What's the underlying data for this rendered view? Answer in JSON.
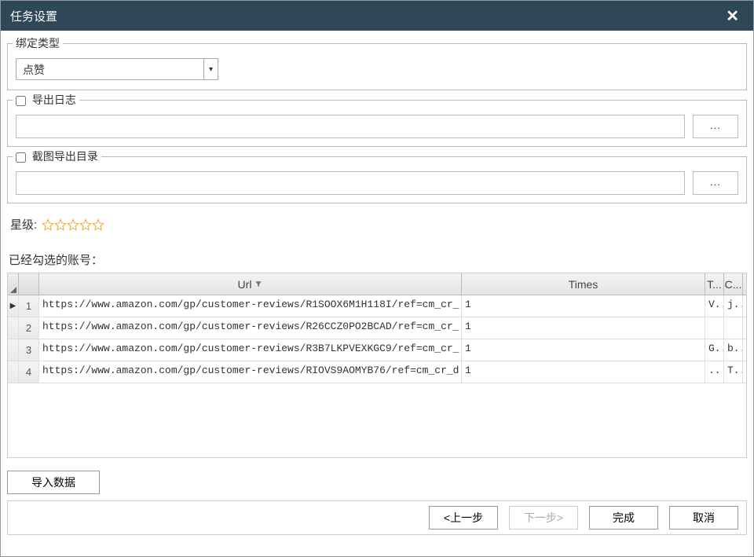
{
  "window": {
    "title": "任务设置"
  },
  "bind_type": {
    "legend": "绑定类型",
    "selected": "点赞"
  },
  "export_log": {
    "legend": "导出日志",
    "path": "",
    "browse": "..."
  },
  "screenshot_dir": {
    "legend": "截图导出目录",
    "path": "",
    "browse": "..."
  },
  "rating": {
    "label": "星级:"
  },
  "account_section": {
    "label": "已经勾选的账号："
  },
  "grid": {
    "headers": {
      "url": "Url",
      "times": "Times",
      "t": "T...",
      "c": "C..."
    },
    "rows": [
      {
        "n": "1",
        "url": "https://www.amazon.com/gp/customer-reviews/R1SOOX6M1H118I/ref=cm_cr_...",
        "times": "1",
        "t": "V..",
        "c": "j.."
      },
      {
        "n": "2",
        "url": "https://www.amazon.com/gp/customer-reviews/R26CCZ0PO2BCAD/ref=cm_cr_...",
        "times": "1",
        "t": "",
        "c": ""
      },
      {
        "n": "3",
        "url": "https://www.amazon.com/gp/customer-reviews/R3B7LKPVEXKGC9/ref=cm_cr_...",
        "times": "1",
        "t": "G..",
        "c": "b.."
      },
      {
        "n": "4",
        "url": "https://www.amazon.com/gp/customer-reviews/RIOVS9AOMYB76/ref=cm_cr_d...",
        "times": "1",
        "t": "..",
        "c": "T.."
      }
    ]
  },
  "buttons": {
    "import": "导入数据",
    "prev": "<上一步",
    "next": "下一步>",
    "finish": "完成",
    "cancel": "取消"
  }
}
